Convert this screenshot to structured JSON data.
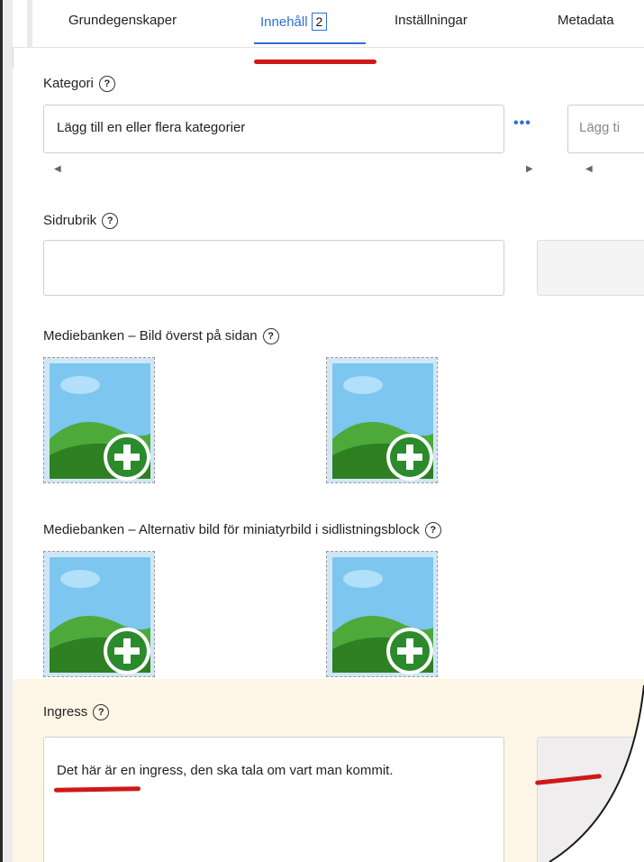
{
  "tabs": [
    {
      "label": "Grundegenskaper"
    },
    {
      "label": "Innehåll",
      "badge": "2"
    },
    {
      "label": "Inställningar"
    },
    {
      "label": "Metadata"
    }
  ],
  "kategori": {
    "label": "Kategori",
    "help": "?",
    "placeholder": "Lägg till en eller flera kategorier",
    "second_placeholder": "Lägg ti"
  },
  "sidrubrik": {
    "label": "Sidrubrik",
    "help": "?"
  },
  "mediebanken_top": {
    "label": "Mediebanken – Bild överst på sidan",
    "help": "?"
  },
  "mediebanken_alt": {
    "label": "Mediebanken – Alternativ bild för miniatyrbild i sidlistningsblock",
    "help": "?"
  },
  "ingress": {
    "label": "Ingress",
    "help": "?",
    "value": "Det här är en ingress, den ska tala om vart man kommit."
  },
  "colors": {
    "accent": "#2f6ed6",
    "annotation": "#d01818",
    "ingress_bg": "#fdf6e6"
  },
  "icons": [
    "help-icon",
    "more-dots-icon",
    "add-image-icon"
  ]
}
